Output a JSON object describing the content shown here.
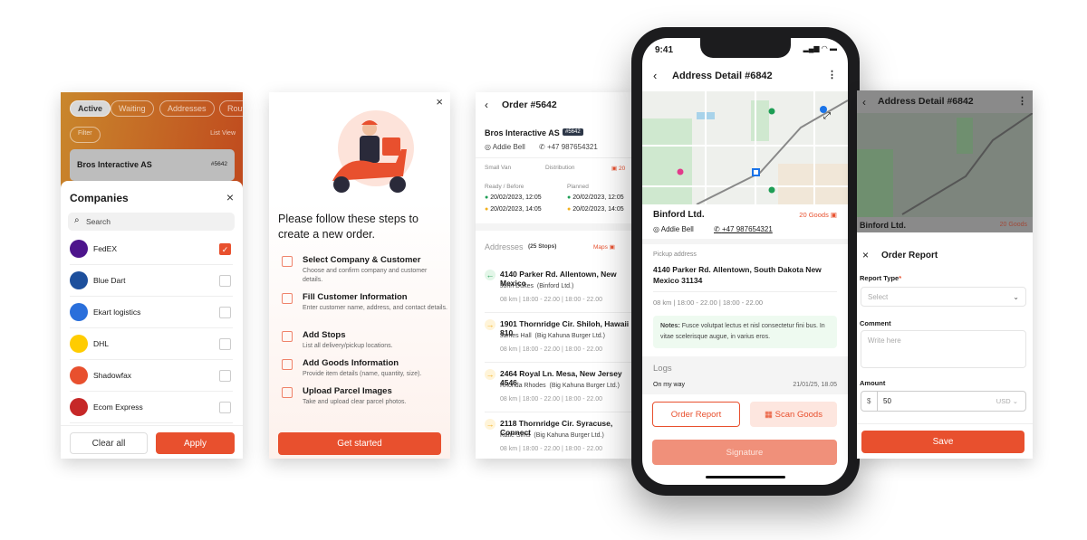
{
  "companies_panel": {
    "tabs": [
      "Active",
      "Waiting",
      "Addresses",
      "Routes"
    ],
    "filter_label": "Filter",
    "list_view_label": "List View",
    "card_title": "Bros Interactive AS",
    "card_id": "#5642",
    "title": "Companies",
    "search_placeholder": "Search",
    "companies": [
      {
        "name": "FedEX",
        "checked": true,
        "logo_color": "#4d148c"
      },
      {
        "name": "Blue Dart",
        "checked": false,
        "logo_color": "#1d4f9c"
      },
      {
        "name": "Ekart logistics",
        "checked": false,
        "logo_color": "#2a6fdb"
      },
      {
        "name": "DHL",
        "checked": false,
        "logo_color": "#ffcc00"
      },
      {
        "name": "Shadowfax",
        "checked": false,
        "logo_color": "#e8502e"
      },
      {
        "name": "Ecom Express",
        "checked": false,
        "logo_color": "#c62828"
      }
    ],
    "clear_label": "Clear all",
    "apply_label": "Apply"
  },
  "onboarding_panel": {
    "title": "Please follow these steps to create a new order.",
    "steps": [
      {
        "title": "Select Company & Customer",
        "desc": "Choose and confirm company and customer details."
      },
      {
        "title": "Fill Customer Information",
        "desc": "Enter customer name, address, and contact details."
      },
      {
        "title": "Add Stops",
        "desc": "List all delivery/pickup locations."
      },
      {
        "title": "Add Goods Information",
        "desc": "Provide item details (name, quantity, size)."
      },
      {
        "title": "Upload Parcel Images",
        "desc": "Take and upload clear parcel photos."
      }
    ],
    "cta": "Get started"
  },
  "order_panel": {
    "title": "Order #5642",
    "company": "Bros Interactive AS",
    "badge": "#5642",
    "contact": "Addie Bell",
    "phone": "+47 987654321",
    "vehicle": "Small Van",
    "type": "Distribution",
    "goods": "20",
    "ready_label": "Ready / Before",
    "planned_label": "Planned",
    "ready": [
      "20/02/2023, 12:05",
      "20/02/2023, 14:05"
    ],
    "planned": [
      "20/02/2023, 12:05",
      "20/02/2023, 14:05"
    ],
    "addresses_label": "Addresses",
    "stops": "(25 Stops)",
    "maps_label": "Maps",
    "addresses": [
      {
        "address": "4140 Parker Rd. Allentown, New Mexico",
        "person": "John Dukes",
        "company": "(Binford Ltd.)",
        "meta": "08 km  |  18:00 - 22.00  |  18:00 - 22.00",
        "direction": "pickup"
      },
      {
        "address": "1901 Thornridge Cir. Shiloh, Hawaii 810",
        "person": "James Hall",
        "company": "(Big Kahuna Burger Ltd.)",
        "meta": "08 km  |  18:00 - 22.00  |  18:00 - 22.00",
        "direction": "delivery"
      },
      {
        "address": "2464 Royal Ln. Mesa, New Jersey 4546",
        "person": "Rhonda Rhodes",
        "company": "(Big Kahuna Burger Ltd.)",
        "meta": "08 km  |  18:00 - 22.00  |  18:00 - 22.00",
        "direction": "delivery"
      },
      {
        "address": "2118 Thornridge Cir. Syracuse, Connect",
        "person": "Katie Sims",
        "company": "(Big Kahuna Burger Ltd.)",
        "meta": "08 km  |  18:00 - 22.00  |  18:00 - 22.00",
        "direction": "delivery"
      }
    ]
  },
  "phone": {
    "time": "9:41",
    "title": "Address Detail  #6842",
    "company": "Binford Ltd.",
    "goods": "20 Goods",
    "contact": "Addie Bell",
    "phone": "+47 987654321",
    "pickup_label": "Pickup address",
    "pickup_address": "4140 Parker Rd. Allentown, South Dakota New Mexico 31134",
    "meta": "08 km  |  18:00 - 22.00  |  18:00 - 22.00",
    "notes_label": "Notes:",
    "notes": "Fusce volutpat lectus et nisl consectetur fini bus. In vitae scelerisque augue, in varius eros.",
    "logs_label": "Logs",
    "log_entry": "On my way",
    "log_time": "21/01/25, 18.05",
    "order_report_label": "Order Report",
    "scan_goods_label": "Scan Goods",
    "signature_label": "Signature"
  },
  "report_panel": {
    "header": "Address Detail  #6842",
    "company": "Binford Ltd.",
    "goods": "20 Goods",
    "title": "Order Report",
    "report_type_label": "Report Type",
    "required": "*",
    "select_placeholder": "Select",
    "comment_label": "Comment",
    "comment_placeholder": "Write here",
    "amount_label": "Amount",
    "currency_symbol": "$",
    "amount": "50",
    "currency": "USD",
    "save_label": "Save"
  },
  "colors": {
    "accent": "#e8502e",
    "green": "#1e9e55",
    "yellow": "#f2b01e"
  }
}
